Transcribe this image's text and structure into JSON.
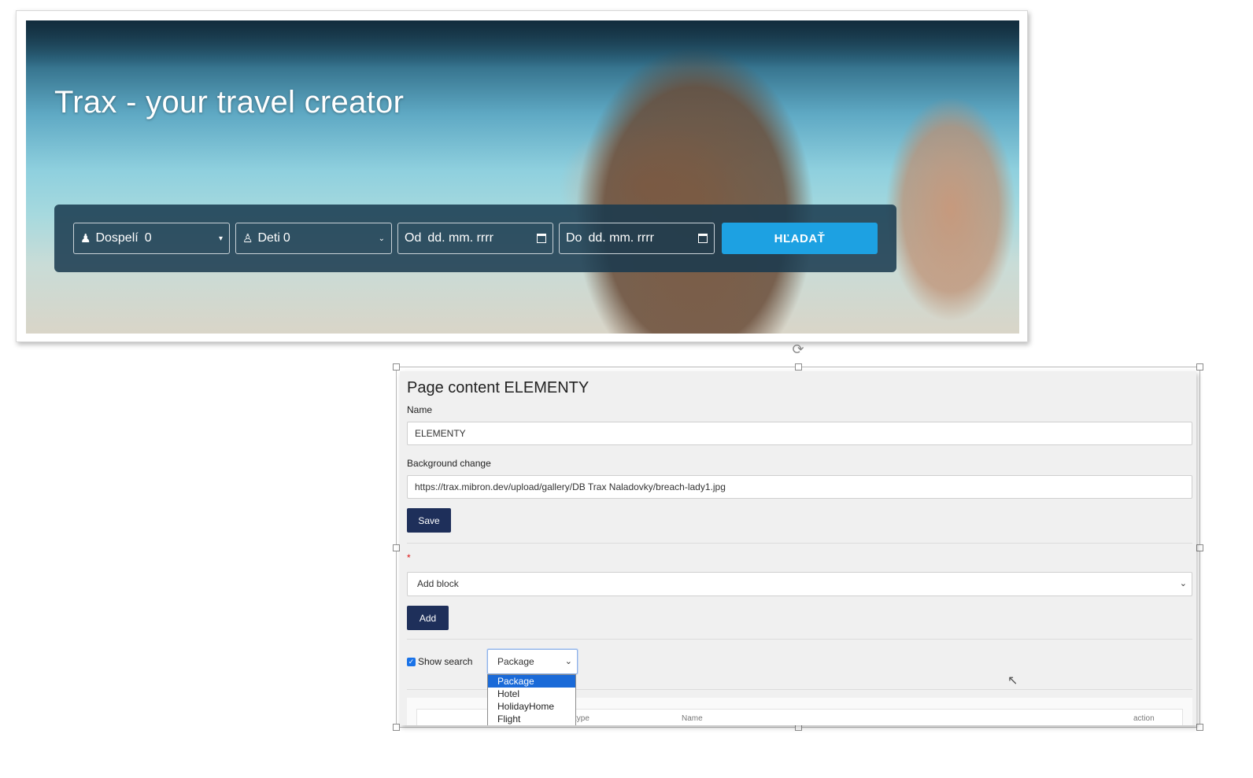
{
  "hero": {
    "title": "Trax - your travel creator",
    "search": {
      "adults_label": "Dospelí",
      "adults_value": "0",
      "kids_label": "Deti",
      "kids_value": "0",
      "from_label": "Od",
      "from_placeholder": "dd. mm. rrrr",
      "to_label": "Do",
      "to_placeholder": "dd. mm. rrrr",
      "search_button": "HĽADAŤ",
      "button_color": "#1da1e2"
    }
  },
  "panel": {
    "title": "Page content ELEMENTY",
    "name_label": "Name",
    "name_value": "ELEMENTY",
    "background_label": "Background change",
    "background_value": "https://trax.mibron.dev/upload/gallery/DB Trax Naladovky/breach-lady1.jpg",
    "save_button": "Save",
    "required_mark": "*",
    "add_block_placeholder": "Add block",
    "add_button": "Add",
    "show_search_label": "Show search",
    "show_search_checked": true,
    "type_select_value": "Package",
    "type_options": [
      "Package",
      "Hotel",
      "HolidayHome",
      "Flight"
    ],
    "table_headers": [
      "type",
      "Name",
      "action"
    ],
    "accent_color": "#1e2f5a"
  }
}
